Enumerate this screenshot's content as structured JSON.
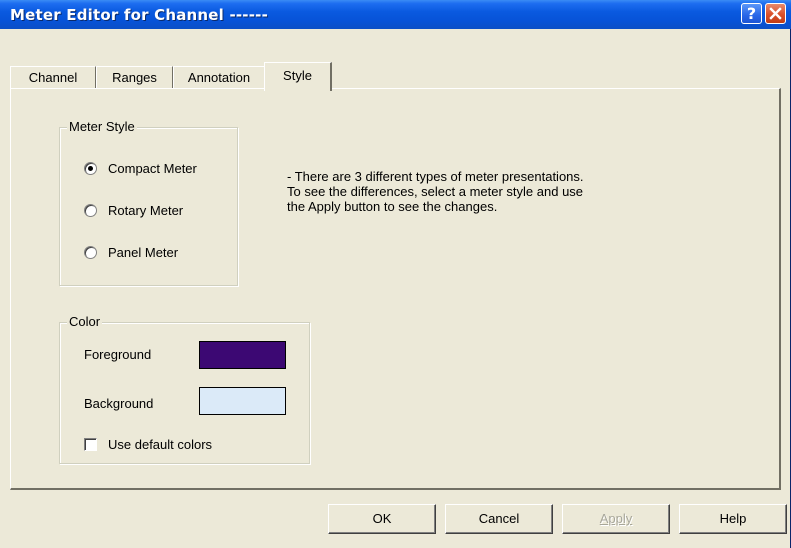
{
  "window": {
    "title": "Meter Editor for Channel ------",
    "help_glyph": "?"
  },
  "tabs": [
    {
      "label": "Channel",
      "active": false
    },
    {
      "label": "Ranges",
      "active": false
    },
    {
      "label": "Annotation",
      "active": false
    },
    {
      "label": "Style",
      "active": true
    }
  ],
  "meter_style": {
    "legend": "Meter Style",
    "options": [
      {
        "label": "Compact Meter",
        "selected": true
      },
      {
        "label": "Rotary Meter",
        "selected": false
      },
      {
        "label": "Panel Meter",
        "selected": false
      }
    ]
  },
  "description": [
    "- There are 3 different types of meter presentations.",
    "To see the differences, select a meter style and use",
    "the Apply button to see the changes."
  ],
  "color": {
    "legend": "Color",
    "foreground_label": "Foreground",
    "foreground_value": "#3c0873",
    "background_label": "Background",
    "background_value": "#dbeaf8",
    "use_default_label": "Use default colors",
    "use_default_checked": false
  },
  "buttons": {
    "ok": "OK",
    "cancel": "Cancel",
    "apply": "Apply",
    "apply_enabled": false,
    "help": "Help"
  }
}
